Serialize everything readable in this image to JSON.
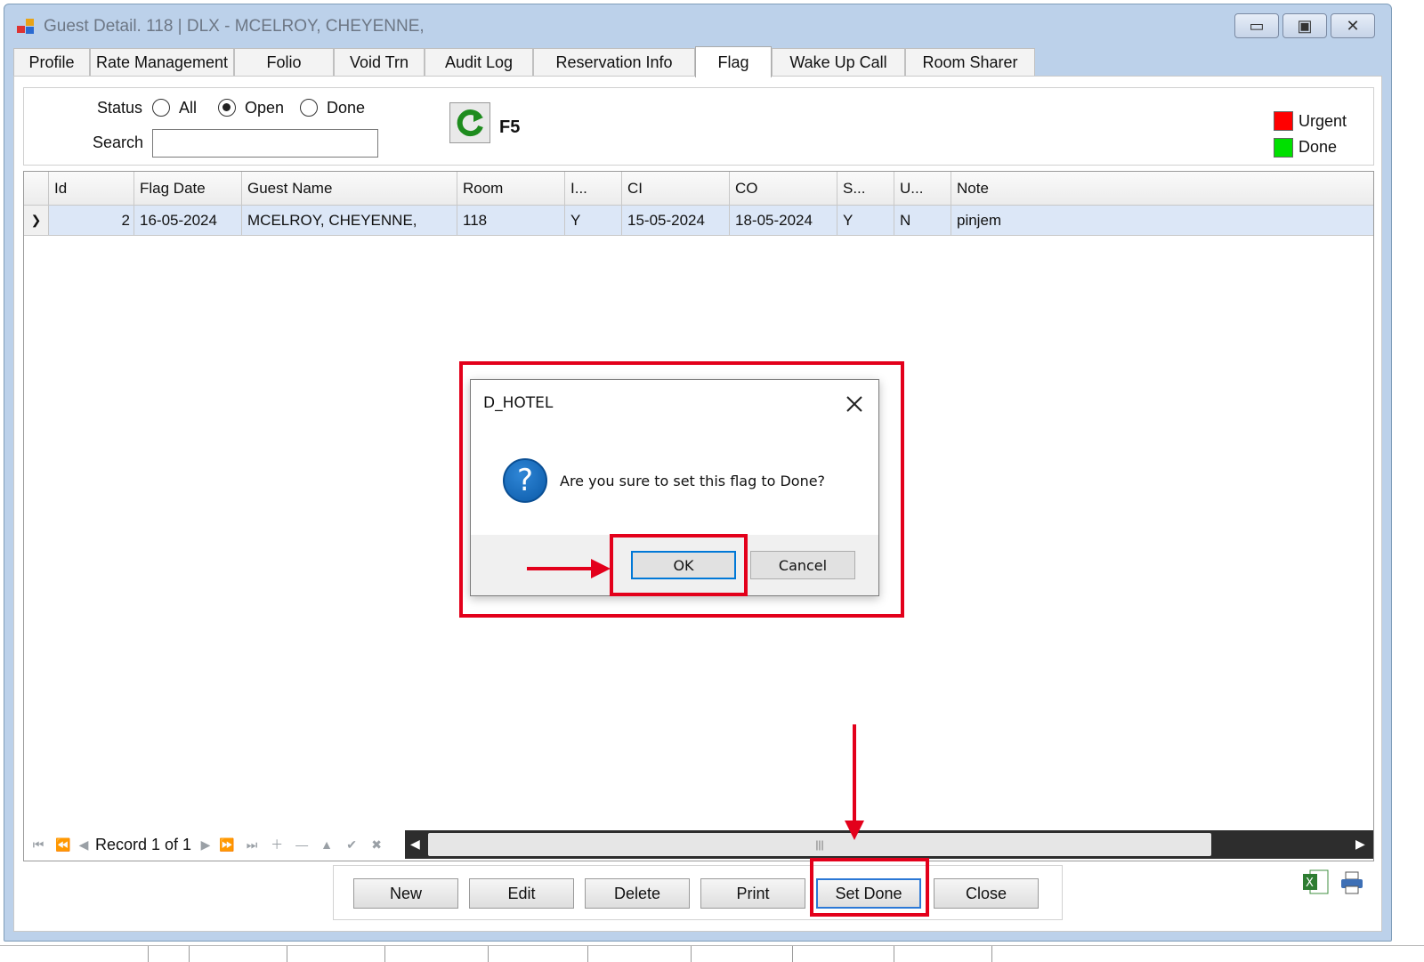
{
  "window": {
    "title": "Guest Detail. 118 | DLX - MCELROY, CHEYENNE,",
    "minimize_symbol": "▭",
    "maximize_symbol": "▣",
    "close_symbol": "✕"
  },
  "tabs": [
    "Profile",
    "Rate Management",
    "Folio",
    "Void Trn",
    "Audit Log",
    "Reservation Info",
    "Flag",
    "Wake Up Call",
    "Room Sharer"
  ],
  "active_tab": "Flag",
  "filter": {
    "status_label": "Status",
    "options": [
      "All",
      "Open",
      "Done"
    ],
    "selected": "Open",
    "search_label": "Search",
    "search_value": "",
    "refresh_hotkey": "F5"
  },
  "legend": [
    {
      "label": "Urgent",
      "color": "#ff0000"
    },
    {
      "label": "Done",
      "color": "#00e000"
    }
  ],
  "grid": {
    "columns": [
      "Id",
      "Flag Date",
      "Guest Name",
      "Room",
      "I...",
      "CI",
      "CO",
      "S...",
      "U...",
      "Note"
    ],
    "rows": [
      {
        "id": "2",
        "flag_date": "16-05-2024",
        "guest_name": "MCELROY, CHEYENNE,",
        "room": "118",
        "i": "Y",
        "ci": "15-05-2024",
        "co": "18-05-2024",
        "s": "Y",
        "u": "N",
        "note": "pinjem"
      }
    ]
  },
  "navigator": {
    "record_text": "Record 1 of 1"
  },
  "buttons": [
    "New",
    "Edit",
    "Delete",
    "Print",
    "Set Done",
    "Close"
  ],
  "dialog": {
    "title": "D_HOTEL",
    "message": "Are you sure to set this flag to Done?",
    "ok_label": "OK",
    "cancel_label": "Cancel"
  },
  "colors": {
    "annotation_red": "#e3001b",
    "selected_row": "#dce7f7",
    "focus_blue": "#0078d7"
  }
}
